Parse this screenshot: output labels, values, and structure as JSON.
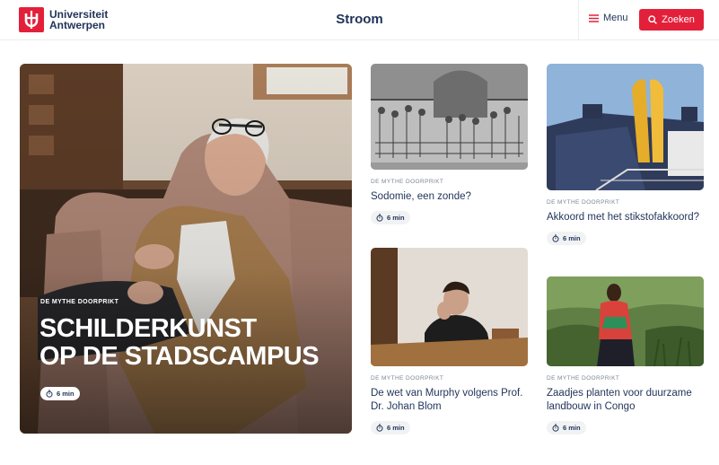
{
  "header": {
    "logo_line1": "Universiteit",
    "logo_line2": "Antwerpen",
    "site_title": "Stroom",
    "menu_label": "Menu",
    "search_label": "Zoeken",
    "icons": {
      "menu": "hamburger-icon",
      "search": "search-icon"
    },
    "colors": {
      "brand_red": "#e3203a",
      "navy": "#1f3358"
    }
  },
  "feature": {
    "kicker": "DE MYTHE DOORPRIKT",
    "title_line1": "Schilderkunst",
    "title_line2": "op de stadscampus",
    "read_time": "6 min"
  },
  "cards": [
    {
      "kicker": "DE MYTHE DOORPRIKT",
      "title": "Sodomie, een zonde?",
      "read_time": "6 min"
    },
    {
      "kicker": "DE MYTHE DOORPRIKT",
      "title": "Akkoord met het stikstofakkoord?",
      "read_time": "6 min"
    },
    {
      "kicker": "DE MYTHE DOORPRIKT",
      "title": "De wet van Murphy volgens Prof. Dr. Johan Blom",
      "read_time": "6 min"
    },
    {
      "kicker": "DE MYTHE DOORPRIKT",
      "title": "Zaadjes planten voor duurzame landbouw in Congo",
      "read_time": "6 min"
    }
  ]
}
